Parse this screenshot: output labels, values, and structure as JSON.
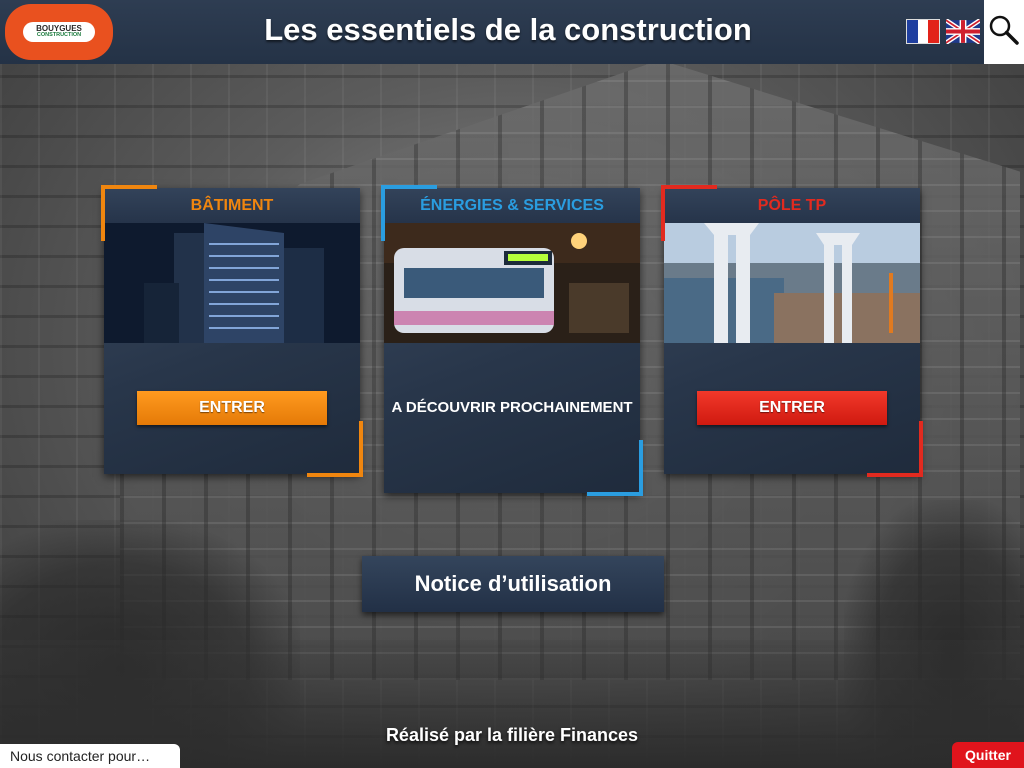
{
  "header": {
    "title": "Les essentiels de la construction",
    "logo_line1": "BOUYGUES",
    "logo_line2": "CONSTRUCTION"
  },
  "colors": {
    "header_bg": "#2e3d52",
    "logo_orange": "#e9511f",
    "batiment_orange": "#f0860f",
    "energies_blue": "#2a9de0",
    "tp_red": "#e22a1f",
    "quit_red": "#e0141c"
  },
  "languages": [
    {
      "name": "Français",
      "icon": "flag-fr-icon"
    },
    {
      "name": "English",
      "icon": "flag-uk-icon"
    }
  ],
  "cards": [
    {
      "title": "BÂTIMENT",
      "action": "ENTRER",
      "photo": "office-tower-night-photo"
    },
    {
      "title": "ÉNERGIES & SERVICES",
      "status": "A DÉCOUVRIR PROCHAINEMENT",
      "photo": "tram-night-photo"
    },
    {
      "title": "PÔLE TP",
      "action": "ENTRER",
      "photo": "bridge-pylons-photo"
    }
  ],
  "notice_label": "Notice d’utilisation",
  "credit": "Réalisé par la filière Finances",
  "contact_label": "Nous contacter pour…",
  "quit_label": "Quitter"
}
